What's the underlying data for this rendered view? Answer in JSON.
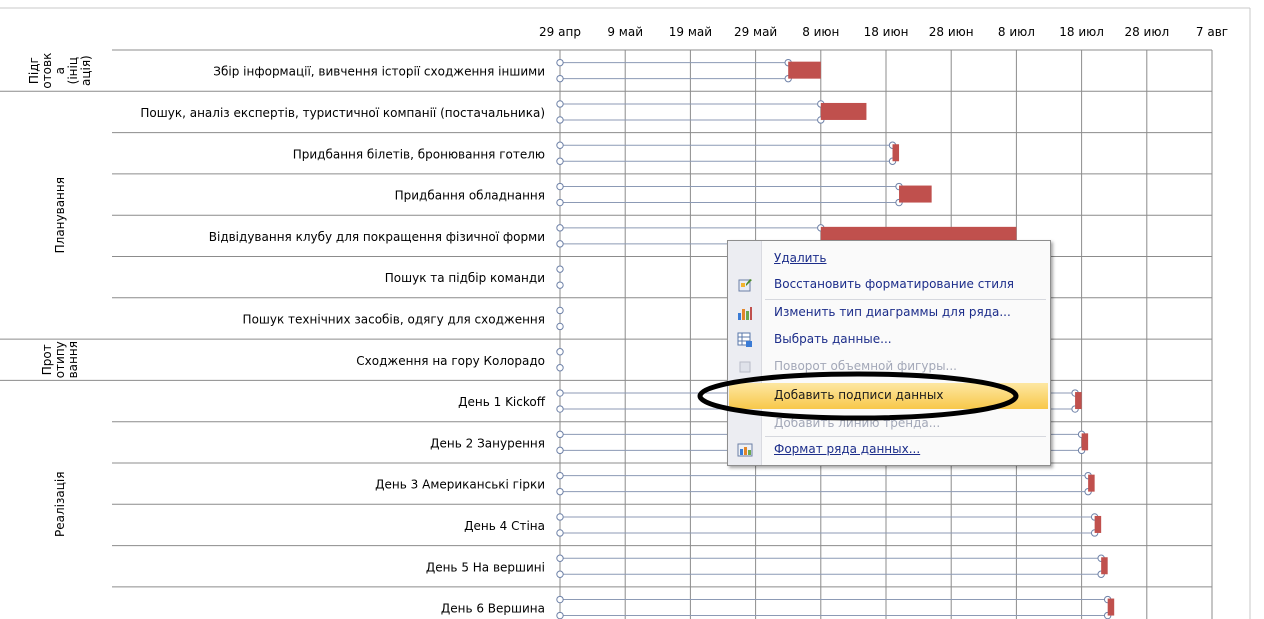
{
  "chart_data": {
    "type": "gantt",
    "x_ticks": [
      "29 апр",
      "9 май",
      "19 май",
      "29 май",
      "8 июн",
      "18 июн",
      "28 июн",
      "8 июл",
      "18 июл",
      "28 июл",
      "7 авг"
    ],
    "xlim": [
      "29 апр",
      "7 авг"
    ],
    "phases": [
      {
        "label": "Підготовка (ініціація)",
        "lines": [
          "Підг",
          "отовк",
          "а",
          "(ініц",
          "ація)"
        ],
        "first_task": 0,
        "task_count": 1
      },
      {
        "label": "Планування",
        "lines": [
          "Планування"
        ],
        "first_task": 1,
        "task_count": 6
      },
      {
        "label": "Прототипування",
        "lines": [
          "Прот",
          "отипу",
          "вання"
        ],
        "first_task": 7,
        "task_count": 1
      },
      {
        "label": "Реалізація",
        "lines": [
          "Реалізація"
        ],
        "first_task": 8,
        "task_count": 6
      }
    ],
    "tasks": [
      {
        "name": "Збір інформації, вивчення історії сходження іншими",
        "start": "2012-06-03",
        "end": "2012-06-08",
        "marker": "2012-06-03"
      },
      {
        "name": "Пошук, аналіз експертів, туристичної компанії (постачальника)",
        "start": "2012-06-08",
        "end": "2012-06-15",
        "marker": "2012-06-08"
      },
      {
        "name": "Придбання білетів, бронювання готелю",
        "start": "2012-06-19",
        "end": "2012-06-20",
        "marker": "2012-06-19"
      },
      {
        "name": "Придбання обладнання",
        "start": "2012-06-20",
        "end": "2012-06-25",
        "marker": "2012-06-20"
      },
      {
        "name": "Відвідування клубу для покращення фізичної форми",
        "start": "2012-06-08",
        "end": "2012-07-08",
        "marker": "2012-06-08"
      },
      {
        "name": "Пошук та підбір команди",
        "start": null,
        "end": null,
        "marker": null
      },
      {
        "name": "Пошук технічних засобів, одягу для сходження",
        "start": null,
        "end": null,
        "marker": null
      },
      {
        "name": "Сходження на гору Колорадо",
        "start": null,
        "end": null,
        "marker": null
      },
      {
        "name": "День 1 Kickoff",
        "start": "2012-07-17",
        "end": "2012-07-18",
        "marker": "2012-07-17"
      },
      {
        "name": "День 2 Занурення",
        "start": "2012-07-18",
        "end": "2012-07-19",
        "marker": "2012-07-18"
      },
      {
        "name": "День 3 Американські гірки",
        "start": "2012-07-19",
        "end": "2012-07-20",
        "marker": "2012-07-19"
      },
      {
        "name": "День 4 Стіна",
        "start": "2012-07-20",
        "end": "2012-07-21",
        "marker": "2012-07-20"
      },
      {
        "name": "День 5 На вершині",
        "start": "2012-07-21",
        "end": "2012-07-22",
        "marker": "2012-07-21"
      },
      {
        "name": "День 6 Вершина",
        "start": "2012-07-22",
        "end": "2012-07-23",
        "marker": "2012-07-22"
      }
    ],
    "grid": true,
    "bar_color": "#c0504d"
  },
  "context_menu": {
    "items": [
      {
        "label": "Удалить",
        "icon": "none",
        "enabled": true,
        "highlighted": false
      },
      {
        "label": "Восстановить форматирование стиля",
        "icon": "reset-style-icon",
        "enabled": true,
        "highlighted": false
      },
      {
        "label": "Изменить тип диаграммы для ряда...",
        "icon": "chart-type-icon",
        "enabled": true,
        "highlighted": false
      },
      {
        "label": "Выбрать данные...",
        "icon": "select-data-icon",
        "enabled": true,
        "highlighted": false
      },
      {
        "label": "Поворот объемной фигуры...",
        "icon": "3d-rotation-icon",
        "enabled": false,
        "highlighted": false
      },
      {
        "label": "Добавить подписи данных",
        "icon": "none",
        "enabled": true,
        "highlighted": true
      },
      {
        "label": "Добавить линию тренда...",
        "icon": "none",
        "enabled": false,
        "highlighted": false
      },
      {
        "label": "Формат ряда данных...",
        "icon": "format-series-icon",
        "enabled": true,
        "highlighted": false
      }
    ],
    "annotation": "black-ellipse-around-highlighted-item"
  }
}
